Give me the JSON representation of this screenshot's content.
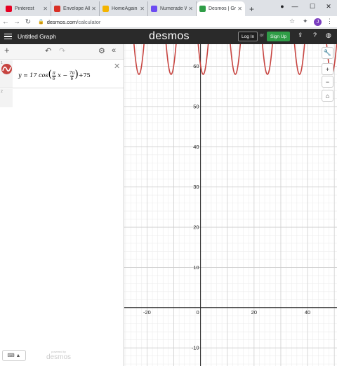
{
  "browser": {
    "tabs": [
      {
        "title": "Pinterest",
        "icon": "pinterest-icon",
        "color": "#e60023"
      },
      {
        "title": "Envelope Allo",
        "icon": "gmail-icon",
        "color": "#d93025"
      },
      {
        "title": "HomeAgain",
        "icon": "homeagain-icon",
        "color": "#f4b400"
      },
      {
        "title": "Numerade W",
        "icon": "numerade-icon",
        "color": "#6c4bf2"
      },
      {
        "title": "Desmos | Gra",
        "icon": "desmos-tab-icon",
        "color": "#2f9d47"
      }
    ],
    "url_host": "desmos.com",
    "url_path": "/calculator",
    "profile_initial": "J"
  },
  "desmos": {
    "graph_title": "Untitled Graph",
    "logo": "desmos",
    "login_label": "Log In",
    "or_label": "or",
    "signup_label": "Sign Up",
    "powered_by": "powered by",
    "powered_logo": "desmos"
  },
  "expressions": [
    {
      "index": "1",
      "color": "#c74440",
      "lhs": "y = 17 cos",
      "frac1_num": "π",
      "frac1_den": "6",
      "var": "x −",
      "frac2_num": "7π",
      "frac2_den": "6",
      "tail": "+75"
    },
    {
      "index": "2"
    }
  ],
  "chart_data": {
    "type": "line",
    "series": [
      {
        "expression": "y = 17cos(πx/6 − 7π/6) + 75",
        "color": "#c74440",
        "amplitude": 17,
        "period": 12,
        "phase_shift": 7,
        "midline": 75
      }
    ],
    "xlim": [
      -28.5,
      51
    ],
    "ylim": [
      -14.5,
      65.5
    ],
    "x_ticks": [
      -20,
      0,
      20,
      40
    ],
    "y_ticks": [
      -10,
      10,
      20,
      30,
      40,
      50,
      60
    ],
    "grid": true
  }
}
